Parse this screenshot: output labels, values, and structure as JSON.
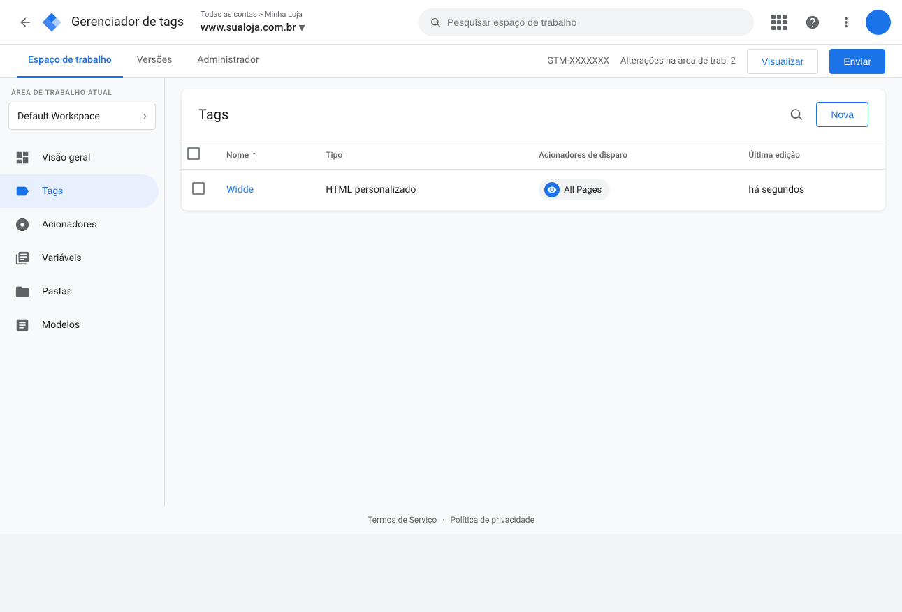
{
  "header": {
    "back_icon": "←",
    "title": "Gerenciador de tags",
    "breadcrumb": "Todas as contas > Minha Loja",
    "url": "www.sualoja.com.br",
    "search_placeholder": "Pesquisar espaço de trabalho",
    "grid_icon": "grid",
    "help_icon": "?",
    "more_icon": "⋮"
  },
  "nav": {
    "tabs": [
      {
        "label": "Espaço de trabalho",
        "active": true
      },
      {
        "label": "Versões",
        "active": false
      },
      {
        "label": "Administrador",
        "active": false
      }
    ],
    "gtm_id": "GTM-XXXXXXX",
    "changes_label": "Alterações na área de trab: 2",
    "btn_visualizar": "Visualizar",
    "btn_enviar": "Enviar"
  },
  "sidebar": {
    "workspace_label": "ÁREA DE TRABALHO ATUAL",
    "workspace_name": "Default Workspace",
    "items": [
      {
        "label": "Visão geral",
        "icon": "overview",
        "active": false
      },
      {
        "label": "Tags",
        "icon": "tag",
        "active": true
      },
      {
        "label": "Acionadores",
        "icon": "trigger",
        "active": false
      },
      {
        "label": "Variáveis",
        "icon": "variable",
        "active": false
      },
      {
        "label": "Pastas",
        "icon": "folder",
        "active": false
      },
      {
        "label": "Modelos",
        "icon": "template",
        "active": false
      }
    ]
  },
  "tags_panel": {
    "title": "Tags",
    "btn_nova": "Nova",
    "columns": {
      "name": "Nome",
      "type": "Tipo",
      "trigger": "Acionadores de disparo",
      "last_edit": "Última edição"
    },
    "rows": [
      {
        "name": "Widde",
        "type": "HTML personalizado",
        "trigger": "All Pages",
        "last_edit": "há segundos"
      }
    ]
  },
  "footer": {
    "terms": "Termos de Serviço",
    "separator": "·",
    "privacy": "Política de privacidade"
  }
}
